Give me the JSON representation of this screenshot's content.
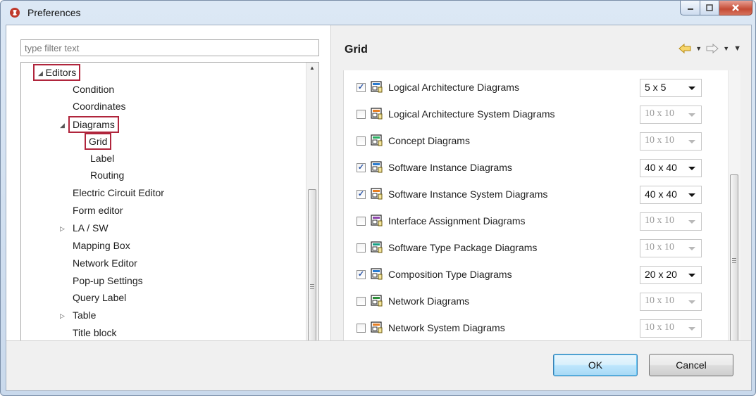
{
  "window": {
    "title": "Preferences"
  },
  "filter": {
    "placeholder": "type filter text"
  },
  "tree": {
    "items": [
      {
        "label": "Editors",
        "expanded": true
      },
      {
        "label": "Condition"
      },
      {
        "label": "Coordinates"
      },
      {
        "label": "Diagrams",
        "expanded": true
      },
      {
        "label": "Grid",
        "selected": true
      },
      {
        "label": "Label"
      },
      {
        "label": "Routing"
      },
      {
        "label": "Electric Circuit Editor"
      },
      {
        "label": "Form editor"
      },
      {
        "label": "LA / SW",
        "expanded": false
      },
      {
        "label": "Mapping Box"
      },
      {
        "label": "Network Editor"
      },
      {
        "label": "Pop-up Settings"
      },
      {
        "label": "Query Label"
      },
      {
        "label": "Table",
        "expanded": false
      },
      {
        "label": "Title block"
      }
    ]
  },
  "page": {
    "title": "Grid"
  },
  "grid_rows": [
    {
      "label": "Logical Architecture Diagrams",
      "checked": true,
      "value": "5 x 5",
      "icon": "logical-architecture-diagram-icon"
    },
    {
      "label": "Logical Architecture System Diagrams",
      "checked": false,
      "value": "10 x 10",
      "icon": "logical-architecture-system-diagram-icon"
    },
    {
      "label": "Concept Diagrams",
      "checked": false,
      "value": "10 x 10",
      "icon": "concept-diagram-icon"
    },
    {
      "label": "Software Instance Diagrams",
      "checked": true,
      "value": "40 x 40",
      "icon": "software-instance-diagram-icon"
    },
    {
      "label": "Software Instance System Diagrams",
      "checked": true,
      "value": "40 x 40",
      "icon": "software-instance-system-diagram-icon"
    },
    {
      "label": "Interface Assignment Diagrams",
      "checked": false,
      "value": "10 x 10",
      "icon": "interface-assignment-diagram-icon"
    },
    {
      "label": "Software Type Package Diagrams",
      "checked": false,
      "value": "10 x 10",
      "icon": "software-type-package-diagram-icon"
    },
    {
      "label": "Composition Type Diagrams",
      "checked": true,
      "value": "20 x 20",
      "icon": "composition-type-diagram-icon"
    },
    {
      "label": "Network Diagrams",
      "checked": false,
      "value": "10 x 10",
      "icon": "network-diagram-icon"
    },
    {
      "label": "Network System Diagrams",
      "checked": false,
      "value": "10 x 10",
      "icon": "network-system-diagram-icon"
    }
  ],
  "buttons": {
    "ok": "OK",
    "cancel": "Cancel"
  },
  "colors": {
    "highlight": "#b0253c",
    "checkmark": "#2a54a6",
    "close_button": "#c44b35"
  }
}
